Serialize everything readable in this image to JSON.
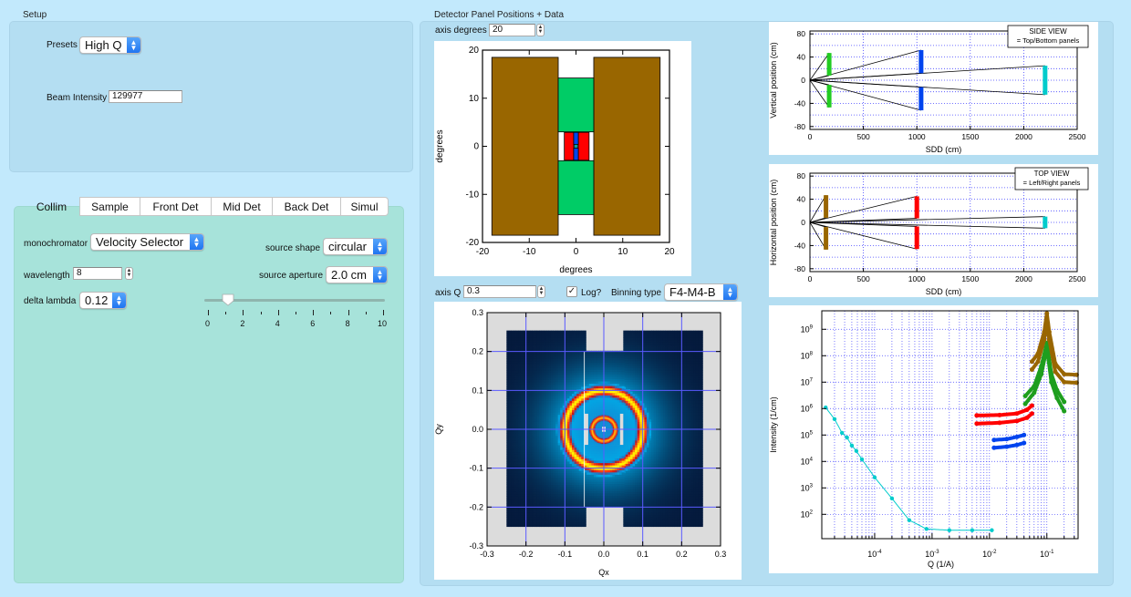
{
  "setup": {
    "group_label": "Setup",
    "presets_label": "Presets",
    "presets_value": "High Q",
    "beam_intensity_label": "Beam Intensity",
    "beam_intensity_value": "129977"
  },
  "tabs": [
    "Collim",
    "Sample",
    "Front Det",
    "Mid Det",
    "Back Det",
    "Simul"
  ],
  "active_tab": "Collim",
  "collim": {
    "monochromator_label": "monochromator",
    "monochromator_value": "Velocity Selector",
    "wavelength_label": "wavelength",
    "wavelength_value": "8",
    "delta_lambda_label": "delta lambda",
    "delta_lambda_value": "0.12",
    "source_shape_label": "source shape",
    "source_shape_value": "circular",
    "source_aperture_label": "source aperture",
    "source_aperture_value": "2.0 cm",
    "slider": {
      "min": 0,
      "max": 10,
      "value": 1,
      "tick_labels": [
        "0",
        "2",
        "4",
        "6",
        "8",
        "10"
      ]
    }
  },
  "detector": {
    "group_label": "Detector Panel Positions + Data",
    "axis_degrees_label": "axis degrees",
    "axis_degrees_value": "20",
    "axis_q_label": "axis Q",
    "axis_q_value": "0.3",
    "log_label": "Log?",
    "log_checked": true,
    "binning_label": "Binning type",
    "binning_value": "F4-M4-B"
  },
  "colors": {
    "brown": "#996600",
    "green": "#00cc66",
    "red": "#ff0000",
    "blue": "#0044ee",
    "cyan": "#00cccc",
    "bright_green": "#22cc22",
    "grid": "#4444ff"
  },
  "chart_data": [
    {
      "id": "panel-map",
      "type": "diagram",
      "xlabel": "degrees",
      "ylabel": "degrees",
      "xlim": [
        -20,
        20
      ],
      "ylim": [
        -20,
        20
      ],
      "xticks": [
        "-20",
        "-10",
        "0",
        "10",
        "20"
      ],
      "yticks": [
        "20",
        "10",
        "0",
        "-10",
        "-20"
      ],
      "panels": [
        {
          "name": "front-left",
          "color": "brown",
          "x": [
            -18,
            -3.8
          ],
          "y": [
            -18.5,
            18.5
          ]
        },
        {
          "name": "front-right",
          "color": "brown",
          "x": [
            3.8,
            18
          ],
          "y": [
            -18.5,
            18.5
          ]
        },
        {
          "name": "front-top",
          "color": "green",
          "x": [
            -3.8,
            3.8
          ],
          "y": [
            3,
            14.2
          ]
        },
        {
          "name": "front-bottom",
          "color": "green",
          "x": [
            -3.8,
            3.8
          ],
          "y": [
            -14.2,
            -3
          ]
        },
        {
          "name": "mid-left",
          "color": "red",
          "x": [
            -2.5,
            -0.5
          ],
          "y": [
            -2.9,
            2.9
          ]
        },
        {
          "name": "mid-right",
          "color": "red",
          "x": [
            0.5,
            2.8
          ],
          "y": [
            -2.9,
            2.9
          ]
        },
        {
          "name": "mid-top",
          "color": "blue",
          "x": [
            -0.5,
            0.5
          ],
          "y": [
            0.4,
            2.9
          ]
        },
        {
          "name": "mid-bottom",
          "color": "blue",
          "x": [
            -0.5,
            0.5
          ],
          "y": [
            -2.9,
            -0.4
          ]
        },
        {
          "name": "back",
          "color": "cyan",
          "x": [
            -0.3,
            0.3
          ],
          "y": [
            -0.4,
            0.4
          ]
        }
      ]
    },
    {
      "id": "side-view",
      "type": "line",
      "legend": [
        "SIDE VIEW",
        "= Top/Bottom panels"
      ],
      "legend_position": "top-right",
      "xlabel": "SDD (cm)",
      "ylabel": "Vertical position (cm)",
      "xlim": [
        0,
        2500
      ],
      "ylim": [
        -85,
        85
      ],
      "xticks": [
        "0",
        "500",
        "1000",
        "1500",
        "2000",
        "2500"
      ],
      "yticks": [
        "80",
        "40",
        "0",
        "-40",
        "-80"
      ],
      "panels": [
        {
          "color": "bright_green",
          "sdd": 180,
          "y": [
            8,
            47
          ]
        },
        {
          "color": "bright_green",
          "sdd": 180,
          "y": [
            -47,
            -8
          ]
        },
        {
          "color": "blue",
          "sdd": 1040,
          "y": [
            12,
            52
          ]
        },
        {
          "color": "blue",
          "sdd": 1040,
          "y": [
            -52,
            -12
          ]
        },
        {
          "color": "cyan",
          "sdd": 2200,
          "y": [
            -25,
            25
          ]
        }
      ]
    },
    {
      "id": "top-view",
      "type": "line",
      "legend": [
        "TOP VIEW",
        "= Left/Right panels"
      ],
      "legend_position": "top-right",
      "xlabel": "SDD (cm)",
      "ylabel": "Horizontal position (cm)",
      "xlim": [
        0,
        2500
      ],
      "ylim": [
        -85,
        85
      ],
      "xticks": [
        "0",
        "500",
        "1000",
        "1500",
        "2000",
        "2500"
      ],
      "yticks": [
        "80",
        "40",
        "0",
        "-40",
        "-80"
      ],
      "panels": [
        {
          "color": "brown",
          "sdd": 150,
          "y": [
            8,
            47
          ]
        },
        {
          "color": "brown",
          "sdd": 150,
          "y": [
            -47,
            -8
          ]
        },
        {
          "color": "red",
          "sdd": 1000,
          "y": [
            7,
            45
          ]
        },
        {
          "color": "red",
          "sdd": 1000,
          "y": [
            -46,
            -7
          ]
        },
        {
          "color": "cyan",
          "sdd": 2200,
          "y": [
            -10,
            10
          ]
        }
      ]
    },
    {
      "id": "q-map",
      "type": "heatmap",
      "xlabel": "Qx",
      "ylabel": "Qy",
      "xlim": [
        -0.3,
        0.3
      ],
      "ylim": [
        -0.3,
        0.3
      ],
      "xticks": [
        "-0.3",
        "-0.2",
        "-0.1",
        "0.0",
        "0.1",
        "0.2",
        "0.3"
      ],
      "yticks": [
        "0.3",
        "0.2",
        "0.1",
        "0.0",
        "-0.1",
        "-0.2",
        "-0.3"
      ],
      "ring_peaks_q": [
        0.1,
        0.03
      ],
      "grid": true
    },
    {
      "id": "iq-plot",
      "type": "scatter",
      "xlabel": "Q (1/A)",
      "ylabel": "Intensity (1/cm)",
      "xscale": "log",
      "yscale": "log",
      "xlim": [
        1.2e-05,
        0.35
      ],
      "ylim": [
        12,
        5000000000
      ],
      "xticks": [
        "10^-4",
        "10^-3",
        "10^-2",
        "10^-1"
      ],
      "yticks": [
        "10^9",
        "10^8",
        "10^7",
        "10^6",
        "10^5",
        "10^4",
        "10^3",
        "10^2"
      ],
      "series": [
        {
          "name": "back",
          "color": "cyan",
          "points": [
            [
              1.4e-05,
              1100000.0
            ],
            [
              2e-05,
              400000.0
            ],
            [
              2.7e-05,
              120000.0
            ],
            [
              3.3e-05,
              80000.0
            ],
            [
              4e-05,
              40000.0
            ],
            [
              4.8e-05,
              25000.0
            ],
            [
              6e-05,
              12000.0
            ],
            [
              0.0001,
              2500.0
            ],
            [
              0.0002,
              400.0
            ],
            [
              0.0004,
              60
            ],
            [
              0.0008,
              28
            ],
            [
              0.002,
              25
            ],
            [
              0.005,
              25
            ],
            [
              0.011,
              25
            ]
          ]
        },
        {
          "name": "mid-tb-1",
          "color": "blue",
          "points": [
            [
              0.012,
              65000.0
            ],
            [
              0.02,
              70000.0
            ],
            [
              0.03,
              85000.0
            ],
            [
              0.04,
              100000.0
            ]
          ]
        },
        {
          "name": "mid-tb-2",
          "color": "blue",
          "points": [
            [
              0.012,
              33000.0
            ],
            [
              0.02,
              36000.0
            ],
            [
              0.03,
              42000.0
            ],
            [
              0.04,
              50000.0
            ]
          ]
        },
        {
          "name": "mid-lr-1",
          "color": "red",
          "points": [
            [
              0.006,
              550000.0
            ],
            [
              0.015,
              570000.0
            ],
            [
              0.03,
              650000.0
            ],
            [
              0.045,
              900000.0
            ],
            [
              0.055,
              1300000.0
            ]
          ]
        },
        {
          "name": "mid-lr-2",
          "color": "red",
          "points": [
            [
              0.006,
              270000.0
            ],
            [
              0.015,
              290000.0
            ],
            [
              0.03,
              340000.0
            ],
            [
              0.045,
              450000.0
            ],
            [
              0.055,
              650000.0
            ]
          ]
        },
        {
          "name": "front-tb-1",
          "color": "green",
          "points": [
            [
              0.042,
              3000000.0
            ],
            [
              0.06,
              7000000.0
            ],
            [
              0.08,
              40000000.0
            ],
            [
              0.1,
              300000000.0
            ],
            [
              0.12,
              20000000.0
            ],
            [
              0.15,
              5000000.0
            ],
            [
              0.2,
              1800000.0
            ]
          ]
        },
        {
          "name": "front-tb-2",
          "color": "green",
          "points": [
            [
              0.042,
              1500000.0
            ],
            [
              0.06,
              4000000.0
            ],
            [
              0.08,
              20000000.0
            ],
            [
              0.1,
              200000000.0
            ],
            [
              0.12,
              10000000.0
            ],
            [
              0.15,
              2500000.0
            ],
            [
              0.2,
              800000.0
            ]
          ]
        },
        {
          "name": "front-lr-1",
          "color": "brown",
          "points": [
            [
              0.055,
              60000000.0
            ],
            [
              0.07,
              120000000.0
            ],
            [
              0.09,
              800000000.0
            ],
            [
              0.1,
              4000000000.0
            ],
            [
              0.11,
              800000000.0
            ],
            [
              0.14,
              50000000.0
            ],
            [
              0.2,
              20000000.0
            ],
            [
              0.33,
              19000000.0
            ]
          ]
        },
        {
          "name": "front-lr-2",
          "color": "brown",
          "points": [
            [
              0.055,
              30000000.0
            ],
            [
              0.07,
              60000000.0
            ],
            [
              0.09,
              400000000.0
            ],
            [
              0.1,
              2000000000.0
            ],
            [
              0.11,
              400000000.0
            ],
            [
              0.14,
              25000000.0
            ],
            [
              0.2,
              10000000.0
            ],
            [
              0.33,
              9500000.0
            ]
          ]
        }
      ]
    }
  ]
}
